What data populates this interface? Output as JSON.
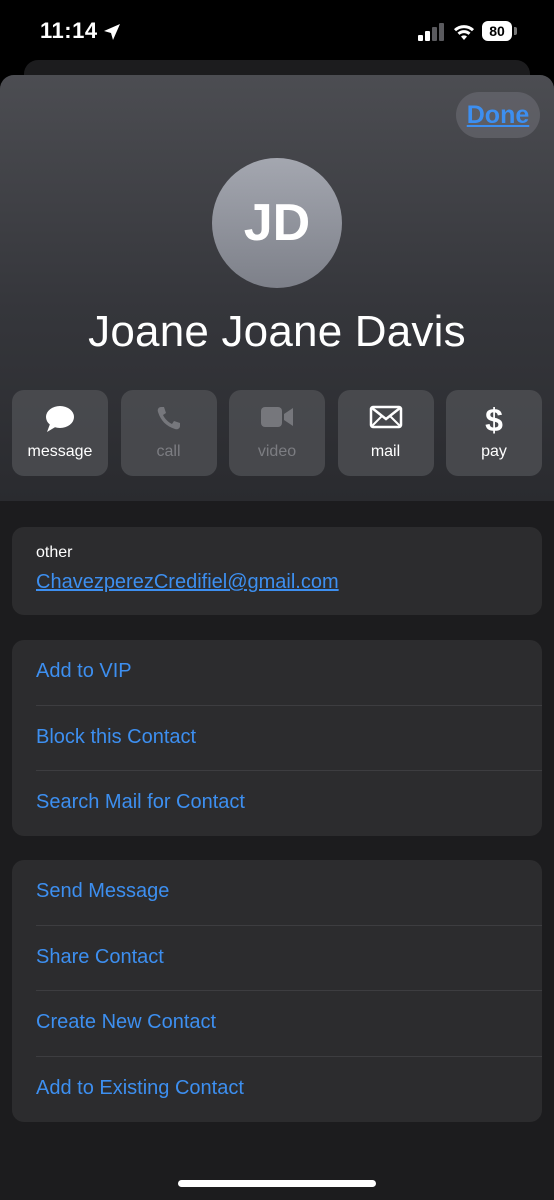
{
  "status_bar": {
    "time": "11:14",
    "battery": "80"
  },
  "header": {
    "done_label": "Done",
    "avatar_initials": "JD",
    "contact_name": "Joane Joane Davis"
  },
  "actions": [
    {
      "label": "message",
      "icon": "message-bubble-icon",
      "enabled": true
    },
    {
      "label": "call",
      "icon": "phone-icon",
      "enabled": false
    },
    {
      "label": "video",
      "icon": "video-camera-icon",
      "enabled": false
    },
    {
      "label": "mail",
      "icon": "envelope-icon",
      "enabled": true
    },
    {
      "label": "pay",
      "icon": "dollar-icon",
      "enabled": true
    }
  ],
  "email": {
    "label": "other",
    "value": "ChavezperezCredifiel@gmail.com"
  },
  "mail_options": [
    "Add to VIP",
    "Block this Contact",
    "Search Mail for Contact"
  ],
  "contact_options": [
    "Send Message",
    "Share Contact",
    "Create New Contact",
    "Add to Existing Contact"
  ],
  "colors": {
    "accent": "#3d8ff0",
    "card": "#2c2c2e",
    "sheet": "#1c1c1e"
  }
}
